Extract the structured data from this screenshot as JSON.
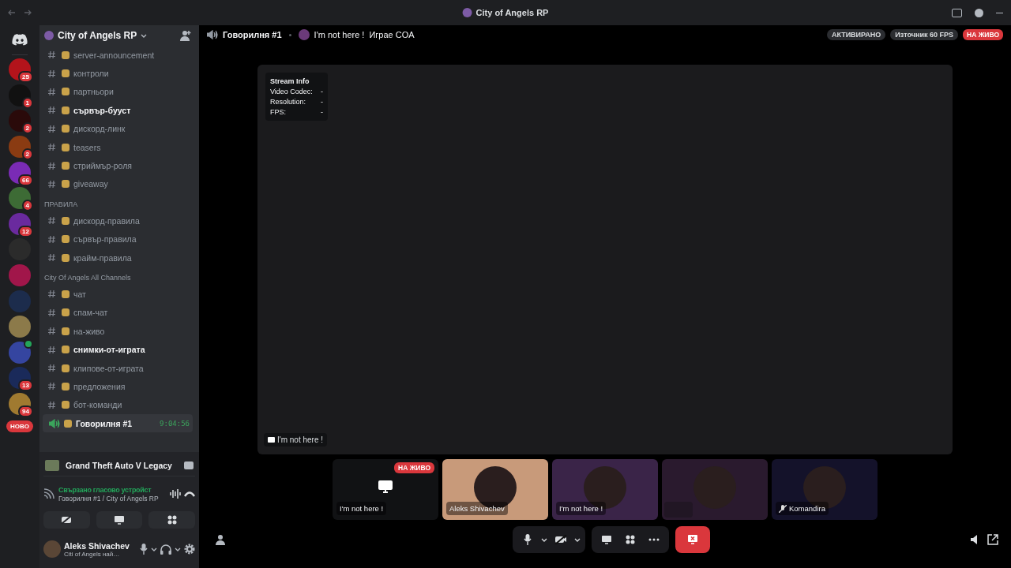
{
  "window": {
    "title": "City of Angels RP"
  },
  "servers": [
    {
      "kind": "badge",
      "badge": "25"
    },
    {
      "kind": "badge",
      "badge": "1"
    },
    {
      "kind": "badge",
      "badge": "2"
    },
    {
      "kind": "badge",
      "badge": "2"
    },
    {
      "kind": "badge",
      "badge": "66"
    },
    {
      "kind": "badge",
      "badge": "4"
    },
    {
      "kind": "badge",
      "badge": "12"
    },
    {
      "kind": "plain"
    },
    {
      "kind": "plain"
    },
    {
      "kind": "plain"
    },
    {
      "kind": "plain"
    },
    {
      "kind": "voice"
    },
    {
      "kind": "badge",
      "badge": "13"
    },
    {
      "kind": "badge",
      "badge": "94"
    }
  ],
  "new_label": "НОВО",
  "server_name": "City of Angels RP",
  "channels": [
    {
      "kind": "text",
      "name": "server-announcement",
      "unread": false
    },
    {
      "kind": "text",
      "name": "контроли",
      "unread": false
    },
    {
      "kind": "text",
      "name": "партньори",
      "unread": false
    },
    {
      "kind": "text",
      "name": "сървър-бууст",
      "unread": true
    },
    {
      "kind": "text",
      "name": "дискорд-линк",
      "unread": false
    },
    {
      "kind": "text",
      "name": "teasers",
      "unread": false
    },
    {
      "kind": "text",
      "name": "стриймър-роля",
      "unread": false
    },
    {
      "kind": "text",
      "name": "giveaway",
      "unread": false
    },
    {
      "kind": "category",
      "name": "ПРАВИЛА"
    },
    {
      "kind": "text",
      "name": "дискорд-правила",
      "unread": false
    },
    {
      "kind": "text",
      "name": "сървър-правила",
      "unread": false
    },
    {
      "kind": "text",
      "name": "крайм-правила",
      "unread": false
    },
    {
      "kind": "category",
      "name": "City Of Angels All Channels"
    },
    {
      "kind": "text",
      "name": "чат",
      "unread": false
    },
    {
      "kind": "text",
      "name": "спам-чат",
      "unread": false
    },
    {
      "kind": "text",
      "name": "на-живо",
      "unread": false
    },
    {
      "kind": "text",
      "name": "снимки-от-играта",
      "unread": true
    },
    {
      "kind": "text",
      "name": "клипове-от-играта",
      "unread": false
    },
    {
      "kind": "text",
      "name": "предложения",
      "unread": false
    },
    {
      "kind": "text",
      "name": "бот-команди",
      "unread": false
    },
    {
      "kind": "voice",
      "name": "Говорилня #1",
      "time": "9:04:56",
      "selected": true
    }
  ],
  "activity": {
    "game": "Grand Theft Auto V Legacy"
  },
  "voice_status": {
    "status": "Свързано гласово устройст",
    "location": "Говорилня #1 / City of Angels RP"
  },
  "user": {
    "name": "Aleks Shivachev",
    "status": "Citi of Angels най…"
  },
  "header": {
    "channel": "Говорилня #1",
    "streamer": "I'm not here !",
    "activity": "Играе COA",
    "enhanced": "АКТИВИРАНО",
    "source": "Източник 60 FPS",
    "live": "НА ЖИВО"
  },
  "stream": {
    "info_title": "Stream Info",
    "info": [
      {
        "label": "Video Codec:",
        "value": "-"
      },
      {
        "label": "Resolution:",
        "value": "-"
      },
      {
        "label": "FPS:",
        "value": "-"
      }
    ],
    "label": "I'm not here !"
  },
  "tiles": [
    {
      "kind": "stream",
      "name": "I'm not here !",
      "live": "НА ЖИВО"
    },
    {
      "kind": "user",
      "name": "Aleks Shivachev",
      "muted": false
    },
    {
      "kind": "user",
      "name": "I'm not here !",
      "muted": false
    },
    {
      "kind": "blank"
    },
    {
      "kind": "user",
      "name": "Komandira",
      "muted": true
    }
  ]
}
